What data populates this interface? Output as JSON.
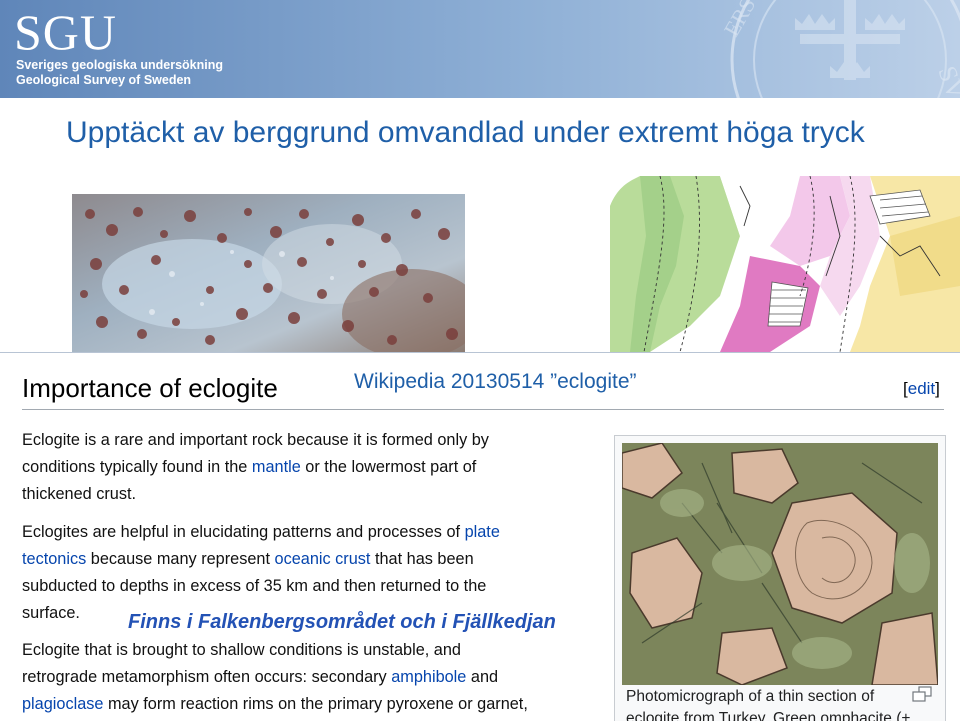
{
  "header": {
    "logo": "SGU",
    "org_line1": "Sveriges geologiska undersökning",
    "org_line2": "Geological Survey of Sweden",
    "seal_text": "SVERIGES"
  },
  "slide": {
    "title": "Upptäckt av berggrund omvandlad under extremt höga tryck"
  },
  "wiki": {
    "heading": "Importance of eclogite",
    "source": "Wikipedia 20130514 ”eclogite”",
    "edit_open": "[",
    "edit_label": "edit",
    "edit_close": "]",
    "p1": {
      "l1": "Eclogite is a rare and important rock because it is formed only by",
      "l2_a": "conditions typically found in the ",
      "l2_link": "mantle",
      "l2_b": " or the lowermost part of",
      "l3": "thickened crust."
    },
    "p2": {
      "l1_a": "Eclogites are helpful in elucidating patterns and processes of ",
      "l1_link": "plate",
      "l2_link1": "tectonics",
      "l2_a": " because many represent ",
      "l2_link2": "oceanic crust",
      "l2_b": " that has been",
      "l3": "subducted to depths in excess of 35 km and then returned to the",
      "l4": "surface."
    },
    "p3": {
      "l1": "Eclogite that is brought to shallow conditions is unstable, and",
      "l2_a": "retrograde metamorphism often occurs: secondary ",
      "l2_link": "amphibole",
      "l2_b": " and",
      "l3_link": "plagioclase",
      "l3_a": " may form reaction rims on the primary pyroxene or garnet,"
    },
    "thumb_caption_l1": "Photomicrograph of a thin section of",
    "thumb_caption_l2": "eclogite from Turkey. Green omphacite (+"
  },
  "overlay_note": "Finns i Falkenbergsområdet och i Fjällkedjan"
}
